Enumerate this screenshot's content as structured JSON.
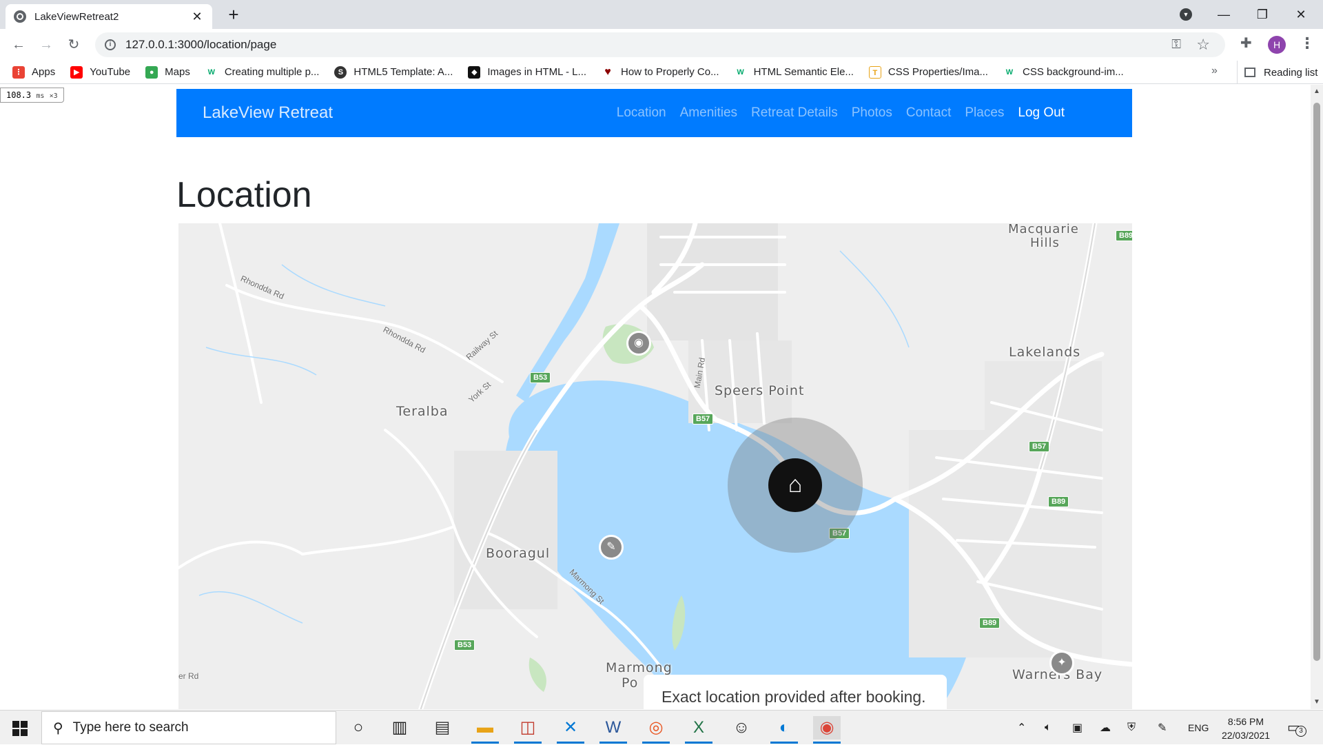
{
  "browser": {
    "tab_title": "LakeViewRetreat2",
    "tab_close": "✕",
    "new_tab": "+",
    "url": "127.0.0.1:3000/location/page",
    "profile_initial": "H",
    "bookmarks": [
      {
        "label": "Apps",
        "icon": "apps-grid-icon",
        "color": "#ea4335"
      },
      {
        "label": "YouTube",
        "icon": "youtube-icon",
        "color": "#ff0000"
      },
      {
        "label": "Maps",
        "icon": "maps-pin-icon",
        "color": "#34a853"
      },
      {
        "label": "Creating multiple p...",
        "icon": "w3schools-icon",
        "color": "#04aa6d"
      },
      {
        "label": "HTML5 Template: A...",
        "icon": "sitepoint-icon",
        "color": "#333333"
      },
      {
        "label": "Images in HTML - L...",
        "icon": "learn-icon",
        "color": "#111111"
      },
      {
        "label": "How to Properly Co...",
        "icon": "heart-icon",
        "color": "#8b0000"
      },
      {
        "label": "HTML Semantic Ele...",
        "icon": "w3schools-icon",
        "color": "#04aa6d"
      },
      {
        "label": "CSS Properties/Ima...",
        "icon": "tutorialspoint-icon",
        "color": "#e8a317"
      },
      {
        "label": "CSS background-im...",
        "icon": "w3schools-icon",
        "color": "#04aa6d"
      }
    ],
    "bookmarks_more": "»",
    "reading_list": "Reading list"
  },
  "perf_badge": {
    "value": "108.3",
    "unit": "ms",
    "mult": "×3"
  },
  "site": {
    "brand": "LakeView Retreat",
    "nav": [
      "Location",
      "Amenities",
      "Retreat Details",
      "Photos",
      "Contact",
      "Places"
    ],
    "logout": "Log Out",
    "page_title": "Location",
    "nav_color": "#007bff"
  },
  "map": {
    "labels": {
      "macquarie": "Macquarie",
      "hills": "Hills",
      "lakelands": "Lakelands",
      "speers_point": "Speers Point",
      "teralba": "Teralba",
      "booragul": "Booragul",
      "marmong": "Marmong",
      "point": "Po",
      "warners_bay": "Warners Bay"
    },
    "roads": {
      "rhondda1": "Rhondda Rd",
      "rhondda2": "Rhondda Rd",
      "railway": "Railway St",
      "york": "York St",
      "main": "Main Rd",
      "marmong_st": "Marmong St",
      "er_rd": "er Rd"
    },
    "shields": {
      "b53a": "B53",
      "b53b": "B53",
      "b57a": "B57",
      "b57b": "B57",
      "b57c": "B57",
      "b89a": "B89",
      "b89b": "B89",
      "b89c": "B89"
    },
    "notice": "Exact location provided after booking.",
    "water_color": "#aadaff",
    "land_color": "#eeeeee"
  },
  "taskbar": {
    "search_placeholder": "Type here to search",
    "language": "ENG",
    "time": "8:56 PM",
    "date": "22/03/2021",
    "notifications": "3"
  }
}
